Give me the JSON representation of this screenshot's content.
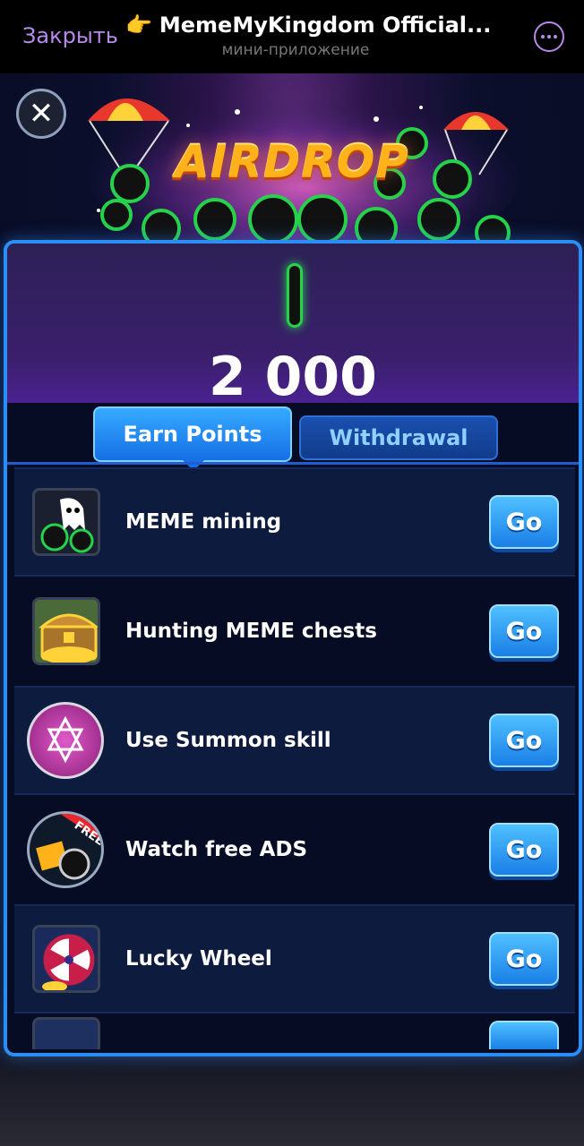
{
  "telegram": {
    "close_label": "Закрыть",
    "title_emoji": "👉",
    "title": "MemeMyKingdom Official...",
    "subtitle": "мини-приложение",
    "more_icon": "more-icon"
  },
  "banner": {
    "title": "AIRDROP"
  },
  "points": {
    "value": "2 000"
  },
  "tabs": [
    {
      "label": "Earn Points",
      "active": true
    },
    {
      "label": "Withdrawal",
      "active": false
    }
  ],
  "tasks": [
    {
      "label": "MEME mining",
      "button": "Go",
      "icon": "ghost-coins-icon"
    },
    {
      "label": "Hunting MEME chests",
      "button": "Go",
      "icon": "treasure-chest-icon"
    },
    {
      "label": "Use Summon skill",
      "button": "Go",
      "icon": "summon-star-icon"
    },
    {
      "label": "Watch free ADS",
      "button": "Go",
      "icon": "free-ads-icon",
      "badge": "FREE"
    },
    {
      "label": "Lucky Wheel",
      "button": "Go",
      "icon": "lucky-wheel-icon"
    }
  ],
  "colors": {
    "accent": "#2c8ef5",
    "go_button": "#1a7fe6",
    "telegram_link": "#b68be8",
    "coin_glow": "#26d24a"
  }
}
